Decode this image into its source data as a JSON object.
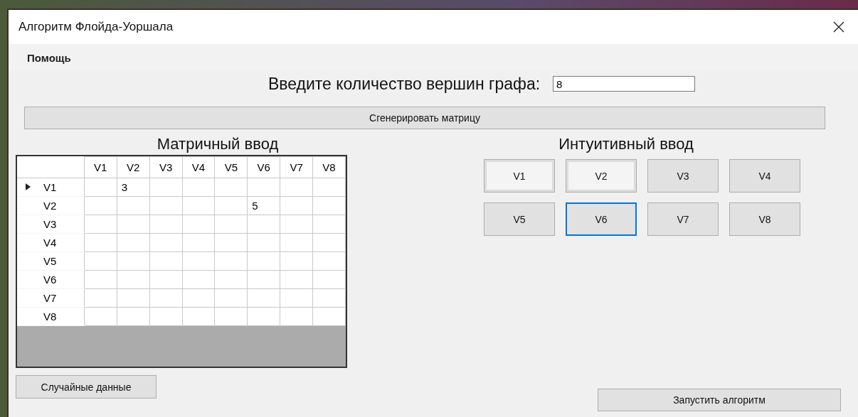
{
  "window": {
    "title": "Алгоритм Флойда-Уоршала"
  },
  "menu": [
    {
      "label": "Помощь"
    }
  ],
  "vertex_count": {
    "label": "Введите количество вершин графа:",
    "value": "8"
  },
  "generate_button": "Сгенерировать матрицу",
  "matrix": {
    "title": "Матричный ввод",
    "columns": [
      "V1",
      "V2",
      "V3",
      "V4",
      "V5",
      "V6",
      "V7",
      "V8"
    ],
    "rows": [
      {
        "label": "V1",
        "current": true,
        "cells": [
          null,
          "3",
          null,
          null,
          null,
          null,
          null,
          null
        ]
      },
      {
        "label": "V2",
        "current": false,
        "cells": [
          null,
          null,
          null,
          null,
          null,
          "5",
          null,
          null
        ]
      },
      {
        "label": "V3",
        "current": false,
        "cells": [
          null,
          null,
          null,
          null,
          null,
          null,
          null,
          null
        ]
      },
      {
        "label": "V4",
        "current": false,
        "cells": [
          null,
          null,
          null,
          null,
          null,
          null,
          null,
          null
        ]
      },
      {
        "label": "V5",
        "current": false,
        "cells": [
          null,
          null,
          null,
          null,
          null,
          null,
          null,
          null
        ]
      },
      {
        "label": "V6",
        "current": false,
        "cells": [
          null,
          null,
          null,
          null,
          null,
          null,
          null,
          null
        ]
      },
      {
        "label": "V7",
        "current": false,
        "cells": [
          null,
          null,
          null,
          null,
          null,
          null,
          null,
          null
        ]
      },
      {
        "label": "V8",
        "current": false,
        "cells": [
          null,
          null,
          null,
          null,
          null,
          null,
          null,
          null
        ]
      }
    ]
  },
  "intuitive": {
    "title": "Интуитивный ввод",
    "vertices": [
      {
        "label": "V1",
        "visited": true,
        "focused": false
      },
      {
        "label": "V2",
        "visited": true,
        "focused": false
      },
      {
        "label": "V3",
        "visited": false,
        "focused": false
      },
      {
        "label": "V4",
        "visited": false,
        "focused": false
      },
      {
        "label": "V5",
        "visited": false,
        "focused": false
      },
      {
        "label": "V6",
        "visited": false,
        "focused": true
      },
      {
        "label": "V7",
        "visited": false,
        "focused": false
      },
      {
        "label": "V8",
        "visited": false,
        "focused": false
      }
    ]
  },
  "random_button": "Случайные данные",
  "run_button": "Запустить алгоритм"
}
